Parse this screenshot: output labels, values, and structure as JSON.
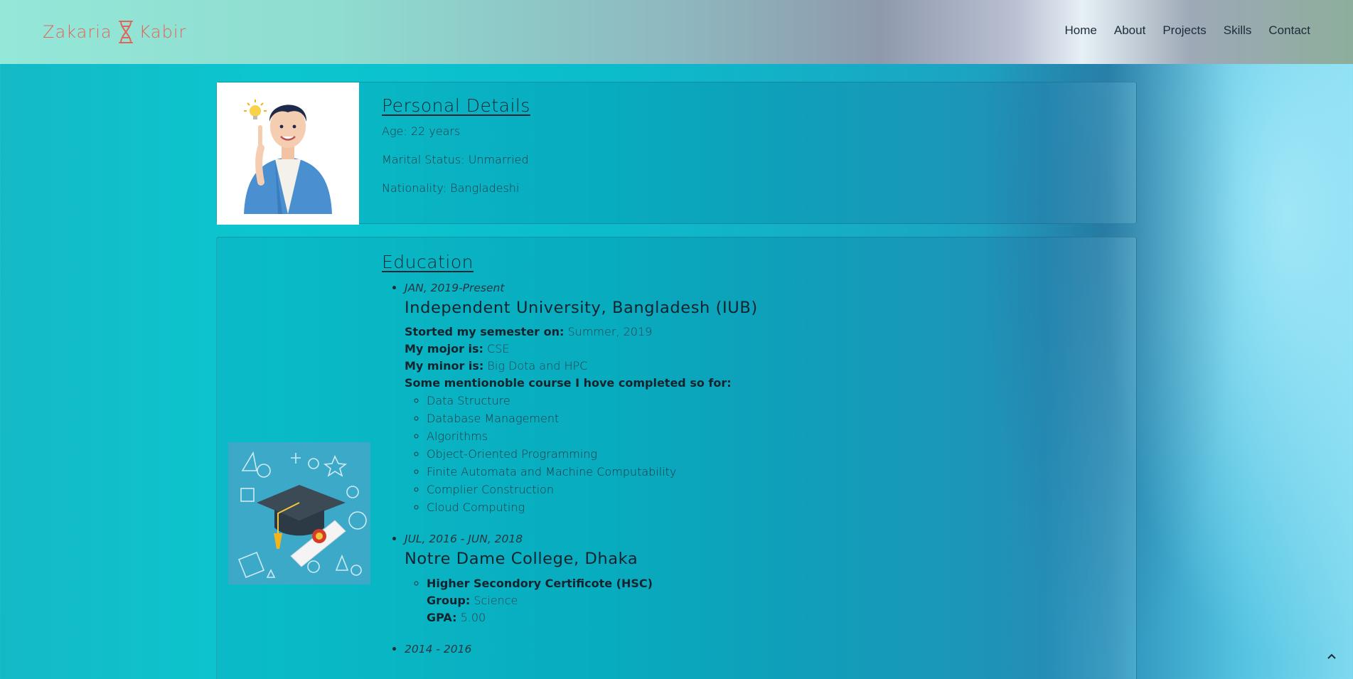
{
  "brand": {
    "name_left": "Zakaria",
    "name_right": "Kabir",
    "logo_icon": "dna-hourglass-icon",
    "color": "#e2645a"
  },
  "nav": {
    "items": [
      "Home",
      "About",
      "Projects",
      "Skills",
      "Contact"
    ]
  },
  "personal": {
    "title": "Personal Details",
    "image_icon": "avatar-illustration-icon",
    "rows": [
      "Age: 22 years",
      "Marital Status: Unmarried",
      "Nationality: Bangladeshi"
    ]
  },
  "education": {
    "title": "Education",
    "image_icon": "graduation-cap-icon",
    "entries": [
      {
        "period": "JAN, 2019-Present",
        "school": "Independent University, Bangladesh (IUB)",
        "started_label": "Storted my semester on:",
        "started_value": "Summer, 2019",
        "major_label": "My mojor is:",
        "major_value": "CSE",
        "minor_label": "My minor is:",
        "minor_value": "Big Dota and HPC",
        "courses_label": "Some mentionoble course I hove completed so for:",
        "courses": [
          "Data Structure",
          "Database Management",
          "Algorithms",
          "Object-Oriented Programming",
          "Finite Automata and Machine Computability",
          "Complier Construction",
          "Cloud Computing"
        ]
      },
      {
        "period": "JUL, 2016 - JUN, 2018",
        "school": "Notre Dame College, Dhaka",
        "cert": "Higher Secondory Certificote (HSC)",
        "group_label": "Group:",
        "group_value": "Science",
        "gpa_label": "GPA:",
        "gpa_value": "5.00"
      },
      {
        "period": "2014 - 2016"
      }
    ]
  },
  "scroll_top_icon": "chevron-up-icon"
}
